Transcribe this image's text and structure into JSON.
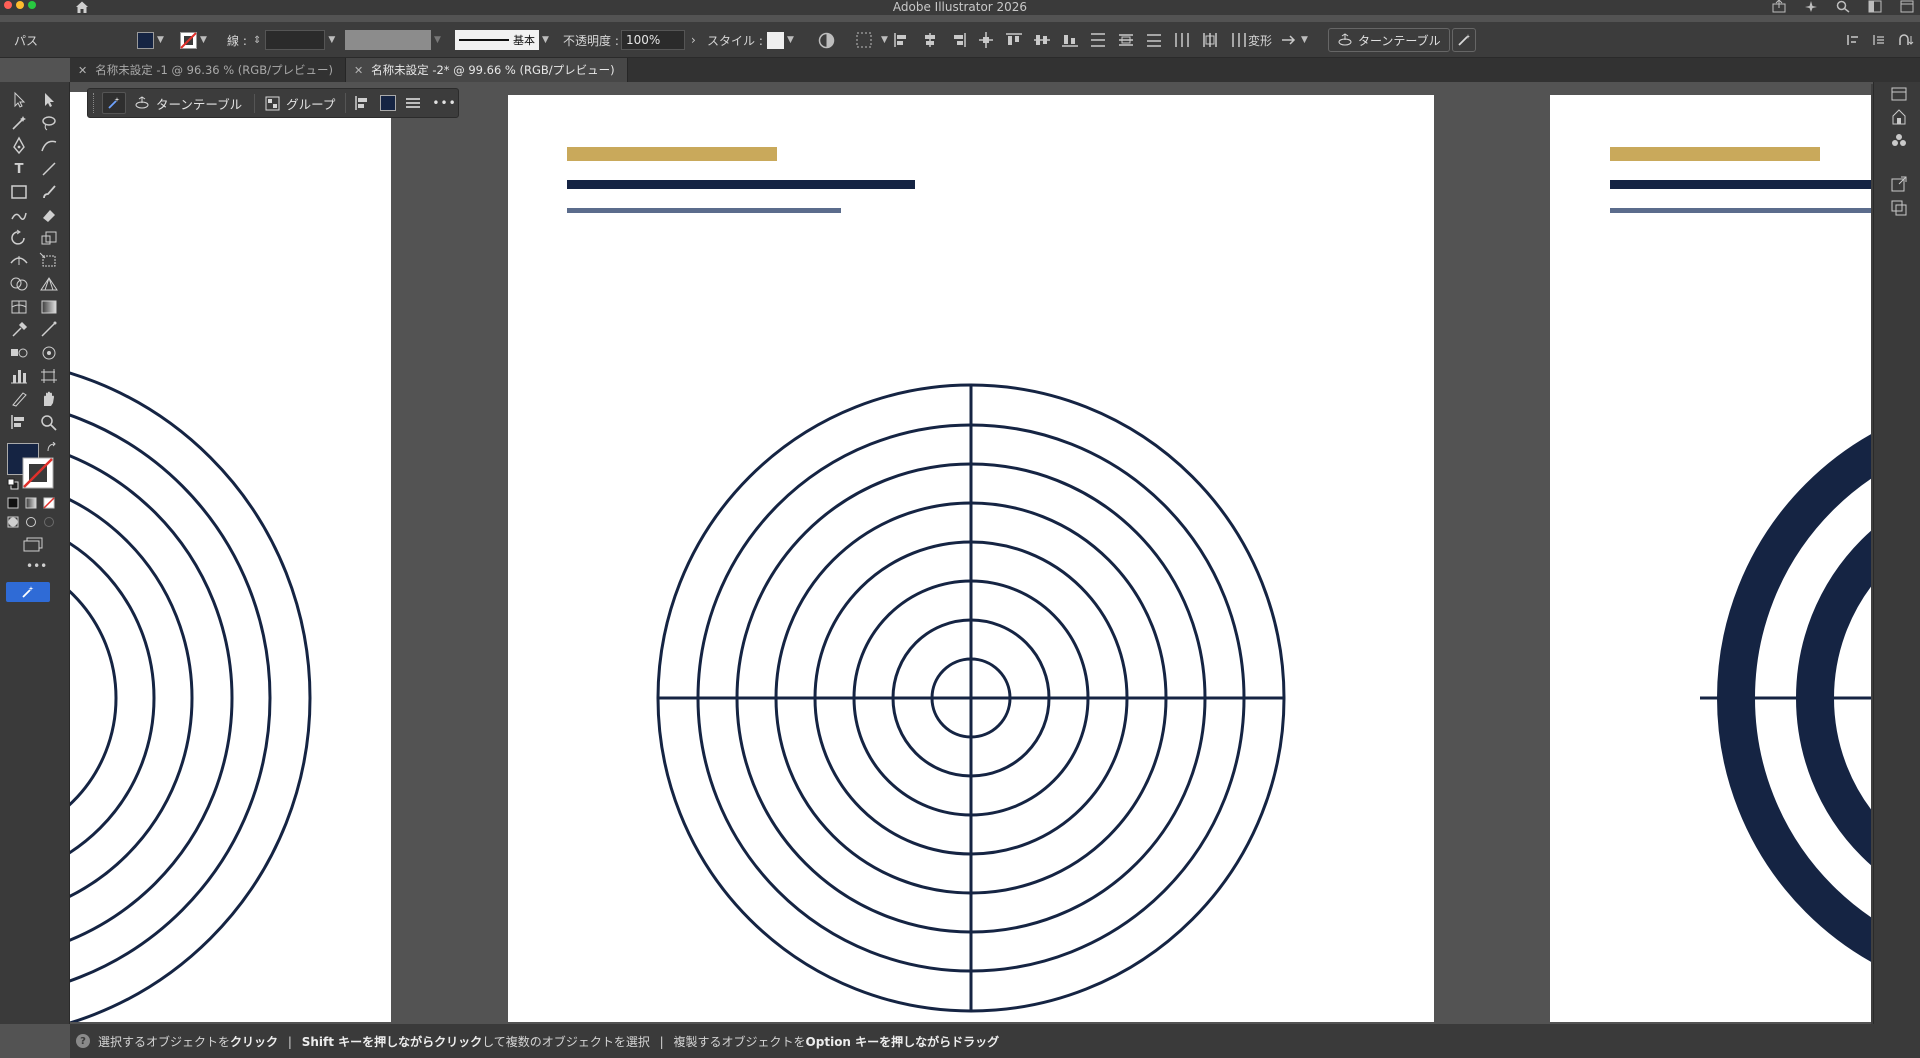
{
  "app": {
    "title": "Adobe Illustrator 2026"
  },
  "control_bar": {
    "selection_type": "パス",
    "stroke_label": "線 :",
    "brush_label": "基本",
    "opacity_label": "不透明度 :",
    "opacity_value": "100%",
    "style_label": "スタイル :",
    "transform_label": "変形",
    "turntable_label": "ターンテーブル",
    "fill_color": "#152443"
  },
  "tabs": [
    {
      "label": "名称未設定 -1 @ 96.36 % (RGB/プレビュー)",
      "active": false
    },
    {
      "label": "名称未設定 -2* @ 99.66 % (RGB/プレビュー)",
      "active": true
    }
  ],
  "context_bar": {
    "turntable_label": "ターンテーブル",
    "group_label": "グループ",
    "more": "•••"
  },
  "artboards": {
    "center": {
      "bars": [
        {
          "color": "#c9a95b"
        },
        {
          "color": "#152443"
        },
        {
          "color": "#5b6c8c"
        }
      ],
      "target": {
        "rings": 8,
        "color": "#152443"
      }
    }
  },
  "colors": {
    "navy": "#152443",
    "gold": "#c9a95b",
    "slate": "#5b6c8c",
    "selected_tool": "#2f6bd6"
  },
  "status": {
    "part1": "選択するオブジェクトを",
    "part1_bold": "クリック",
    "sep1": "|",
    "part2_bold": "Shift キーを押しながらクリック",
    "part2": "して複数のオブジェクトを選択",
    "sep2": "|",
    "part3": "複製するオブジェクトを",
    "part3_bold": "Option キーを押しながらドラッグ"
  }
}
